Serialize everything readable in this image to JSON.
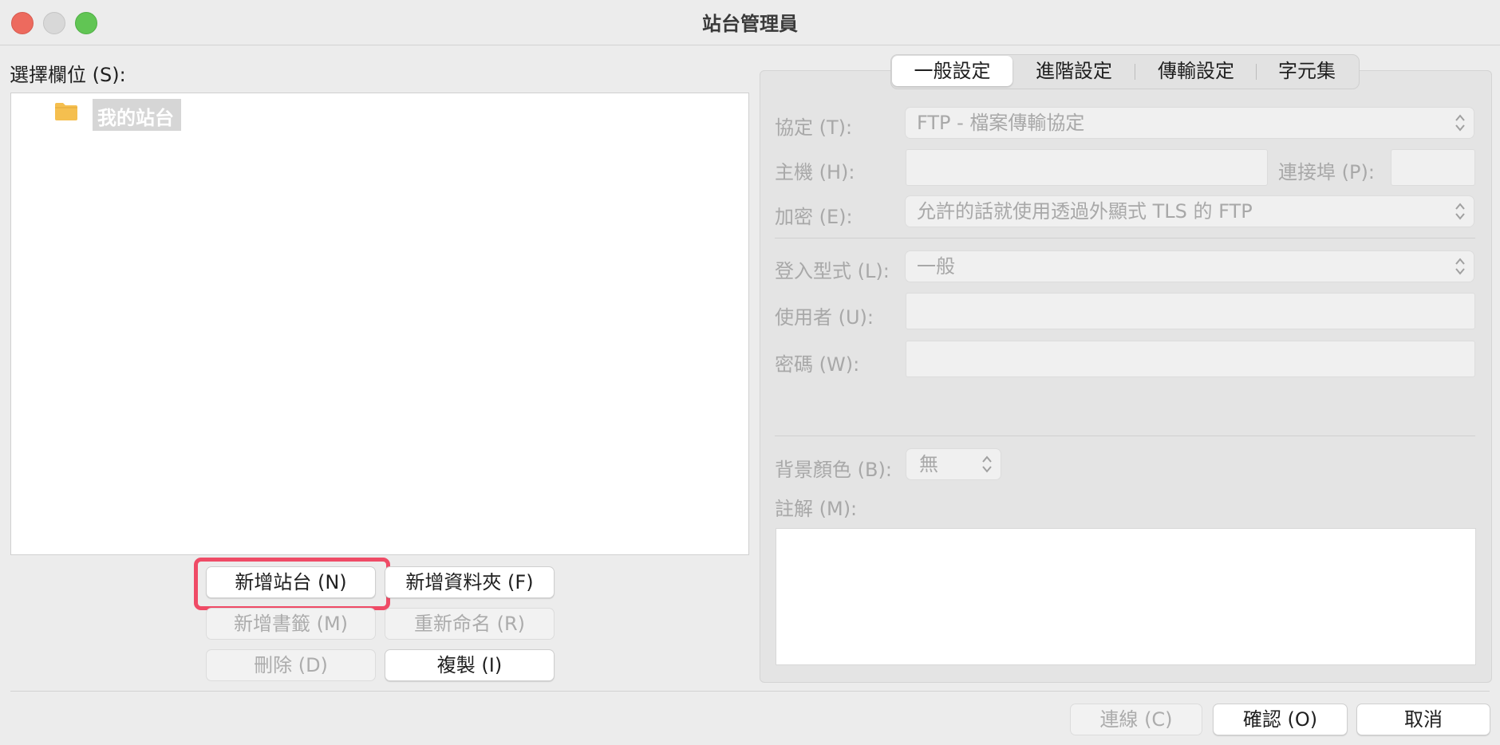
{
  "window": {
    "title": "站台管理員"
  },
  "left": {
    "select_label": "選擇欄位 (S):",
    "tree": [
      {
        "label": "我的站台",
        "icon": "folder-icon",
        "selected": true
      }
    ],
    "buttons": {
      "new_site": "新增站台 (N)",
      "new_folder": "新增資料夾 (F)",
      "new_bookmark": "新增書籤 (M)",
      "rename": "重新命名 (R)",
      "delete": "刪除 (D)",
      "duplicate": "複製 (I)"
    }
  },
  "tabs": [
    "一般設定",
    "進階設定",
    "傳輸設定",
    "字元集"
  ],
  "active_tab": "一般設定",
  "general": {
    "protocol_label": "協定 (T):",
    "protocol_value": "FTP - 檔案傳輸協定",
    "host_label": "主機 (H):",
    "host_value": "",
    "port_label": "連接埠 (P):",
    "port_value": "",
    "encryption_label": "加密 (E):",
    "encryption_value": "允許的話就使用透過外顯式 TLS 的 FTP",
    "logon_label": "登入型式 (L):",
    "logon_value": "一般",
    "user_label": "使用者 (U):",
    "user_value": "",
    "password_label": "密碼 (W):",
    "password_value": "",
    "bgcolor_label": "背景顏色 (B):",
    "bgcolor_value": "無",
    "comments_label": "註解 (M):"
  },
  "footer": {
    "connect": "連線 (C)",
    "ok": "確認 (O)",
    "cancel": "取消"
  },
  "colors": {
    "highlight": "#ef4b66",
    "folder": "#f5bf4f"
  }
}
